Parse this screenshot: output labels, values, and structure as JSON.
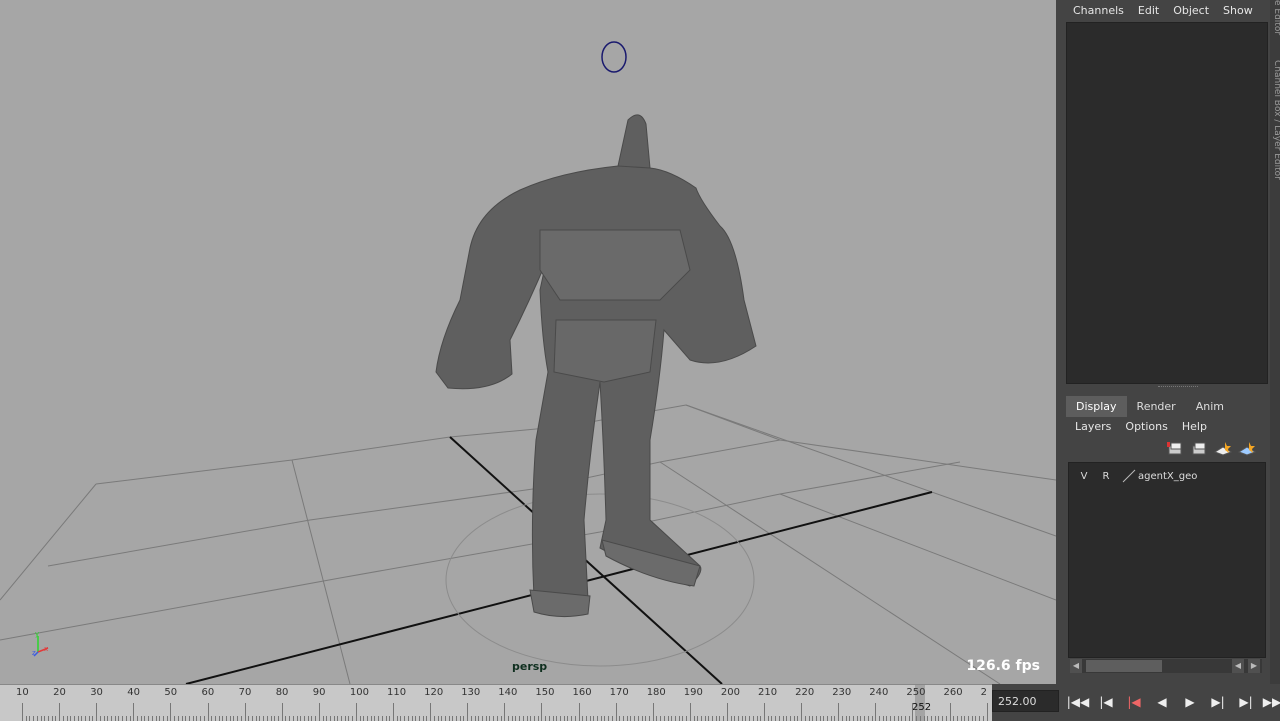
{
  "viewport": {
    "camera_label": "persp",
    "fps": "126.6 fps",
    "axis_labels": {
      "y": "y",
      "z": "z",
      "x": "x"
    }
  },
  "right_panel": {
    "menu": [
      "Channels",
      "Edit",
      "Object",
      "Show"
    ],
    "side_tab_top": "e Editor",
    "side_tab": "Channel Box / Layer Editor",
    "tabs": [
      "Display",
      "Render",
      "Anim"
    ],
    "active_tab": "Display",
    "layer_menu": [
      "Layers",
      "Options",
      "Help"
    ],
    "layer_icons": [
      "new-layer-icon",
      "new-layer-selected-icon",
      "add-layer-icon",
      "empty-layer-icon"
    ],
    "layers": [
      {
        "visible": "V",
        "render": "R",
        "name": "agentX_geo"
      }
    ]
  },
  "timeline": {
    "ticks": [
      10,
      20,
      30,
      40,
      50,
      60,
      70,
      80,
      90,
      100,
      110,
      120,
      130,
      140,
      150,
      160,
      170,
      180,
      190,
      200,
      210,
      220,
      230,
      240,
      250,
      260,
      2
    ],
    "current_frame": "252",
    "frame_field": "252.00"
  },
  "playback": {
    "buttons": [
      "go-to-start-icon",
      "step-back-key-icon",
      "step-back-frame-icon",
      "play-backward-icon",
      "play-forward-icon",
      "step-forward-frame-icon",
      "step-forward-key-icon",
      "go-to-end-icon"
    ]
  },
  "colors": {
    "viewport_bg": "#a6a6a6",
    "panel_bg": "#444444",
    "field_bg": "#2b2b2b",
    "mesh": "#5f5f5f"
  }
}
